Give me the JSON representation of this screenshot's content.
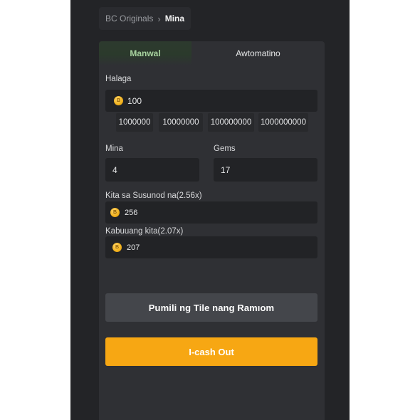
{
  "breadcrumb": {
    "parent": "BC Originals",
    "separator": "›",
    "current": "Mina"
  },
  "tabs": [
    {
      "label": "Manwal"
    },
    {
      "label": "Awtomatino"
    }
  ],
  "bet": {
    "label": "Halaga",
    "value": "100",
    "presets": [
      "1000000",
      "10000000",
      "100000000",
      "1000000000"
    ]
  },
  "mines": {
    "label": "Mina",
    "value": "4"
  },
  "gems": {
    "label": "Gems",
    "value": "17"
  },
  "next_profit": {
    "label": "Kita sa Susunod na(2.56x)",
    "value": "256"
  },
  "total_profit": {
    "label": "Kabuuang kita(2.07x)",
    "value": "207"
  },
  "buttons": {
    "random": "Pumili ng Tile nang Ramıom",
    "cashout": "I-cash Out"
  },
  "coin_icon_glyph": "B",
  "colors": {
    "accent": "#f7a713",
    "manual_tab": "#a8d3a0"
  }
}
